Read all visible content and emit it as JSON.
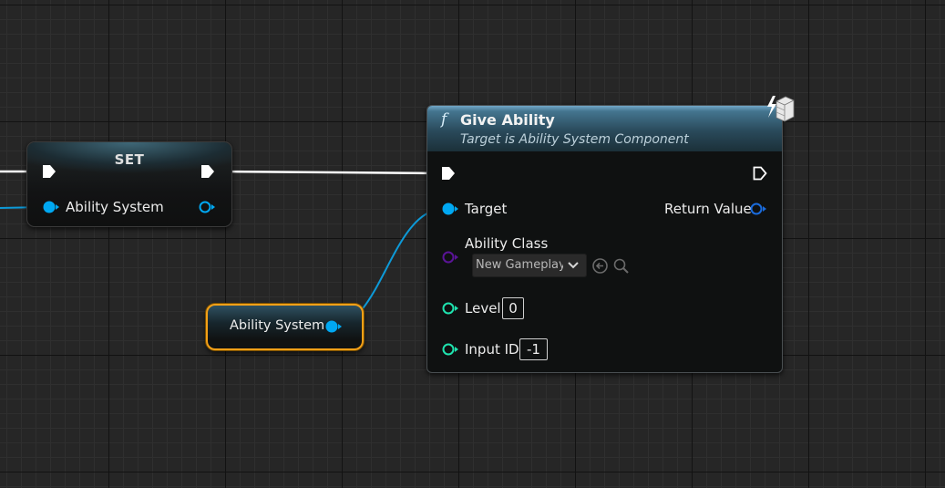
{
  "set_node": {
    "title": "SET",
    "pin_label": "Ability System"
  },
  "give_ability_node": {
    "title": "Give Ability",
    "subtitle": "Target is Ability System Component",
    "function_icon": "f",
    "target_label": "Target",
    "return_label": "Return Value",
    "ability_class_label": "Ability Class",
    "ability_class_value": "New Gameplay A",
    "level_label": "Level",
    "level_value": "0",
    "input_id_label": "Input ID",
    "input_id_value": "-1"
  },
  "getter_node": {
    "label": "Ability System"
  },
  "colors": {
    "exec_white": "#ffffff",
    "object_blue": "#00a8f2",
    "class_purple": "#5a1497",
    "int_green": "#1fe3af",
    "getter_outline": "#f3a017",
    "return_blue": "#1a6bdc"
  },
  "icons": [
    "function-icon",
    "server-only-icon",
    "chevron-down-icon",
    "use-selected-asset-icon",
    "browse-asset-icon"
  ]
}
